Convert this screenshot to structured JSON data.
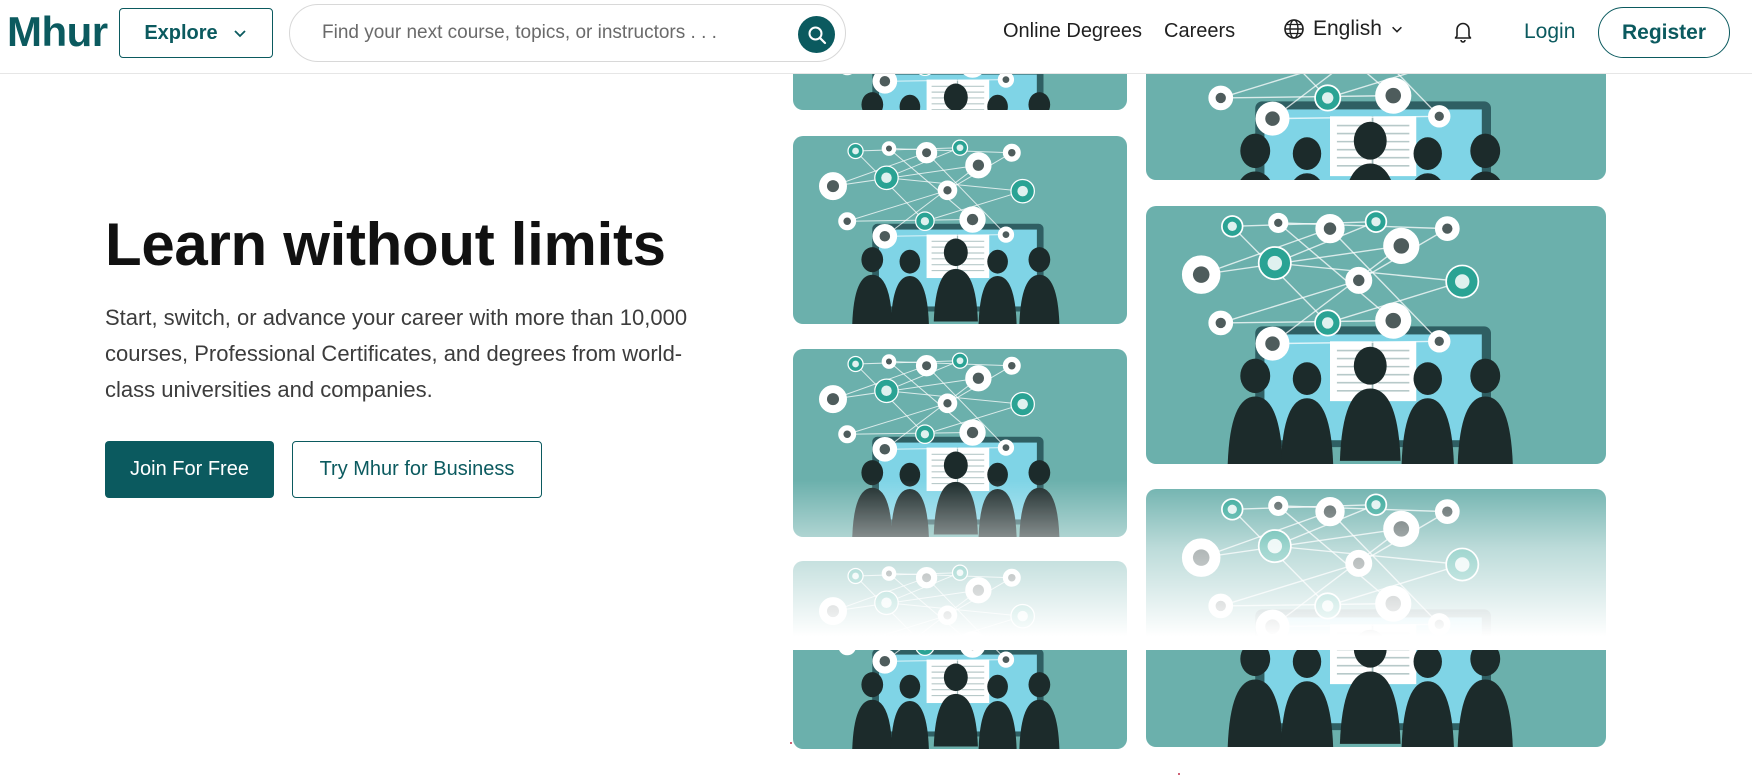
{
  "header": {
    "logo": "Mhur",
    "explore_label": "Explore",
    "search_placeholder": "Find your next course, topics, or instructors . . .",
    "nav": {
      "online_degrees": "Online Degrees",
      "careers": "Careers"
    },
    "language": "English",
    "login_label": "Login",
    "register_label": "Register"
  },
  "hero": {
    "title": "Learn without limits",
    "subtitle": "Start, switch, or advance your career with more than 10,000 courses, Professional Certificates, and degrees from world-class universities and companies.",
    "primary_cta": "Join For Free",
    "secondary_cta": "Try Mhur for Business"
  },
  "colors": {
    "brand": "#0b5a5f",
    "tile_bg": "#6bb0ac",
    "screen": "#7fd4e6",
    "silhouette": "#1c2b2b",
    "icon_accent": "#2aa394"
  },
  "icons": [
    "search-icon",
    "chevron-down-icon",
    "globe-icon",
    "bell-icon"
  ]
}
